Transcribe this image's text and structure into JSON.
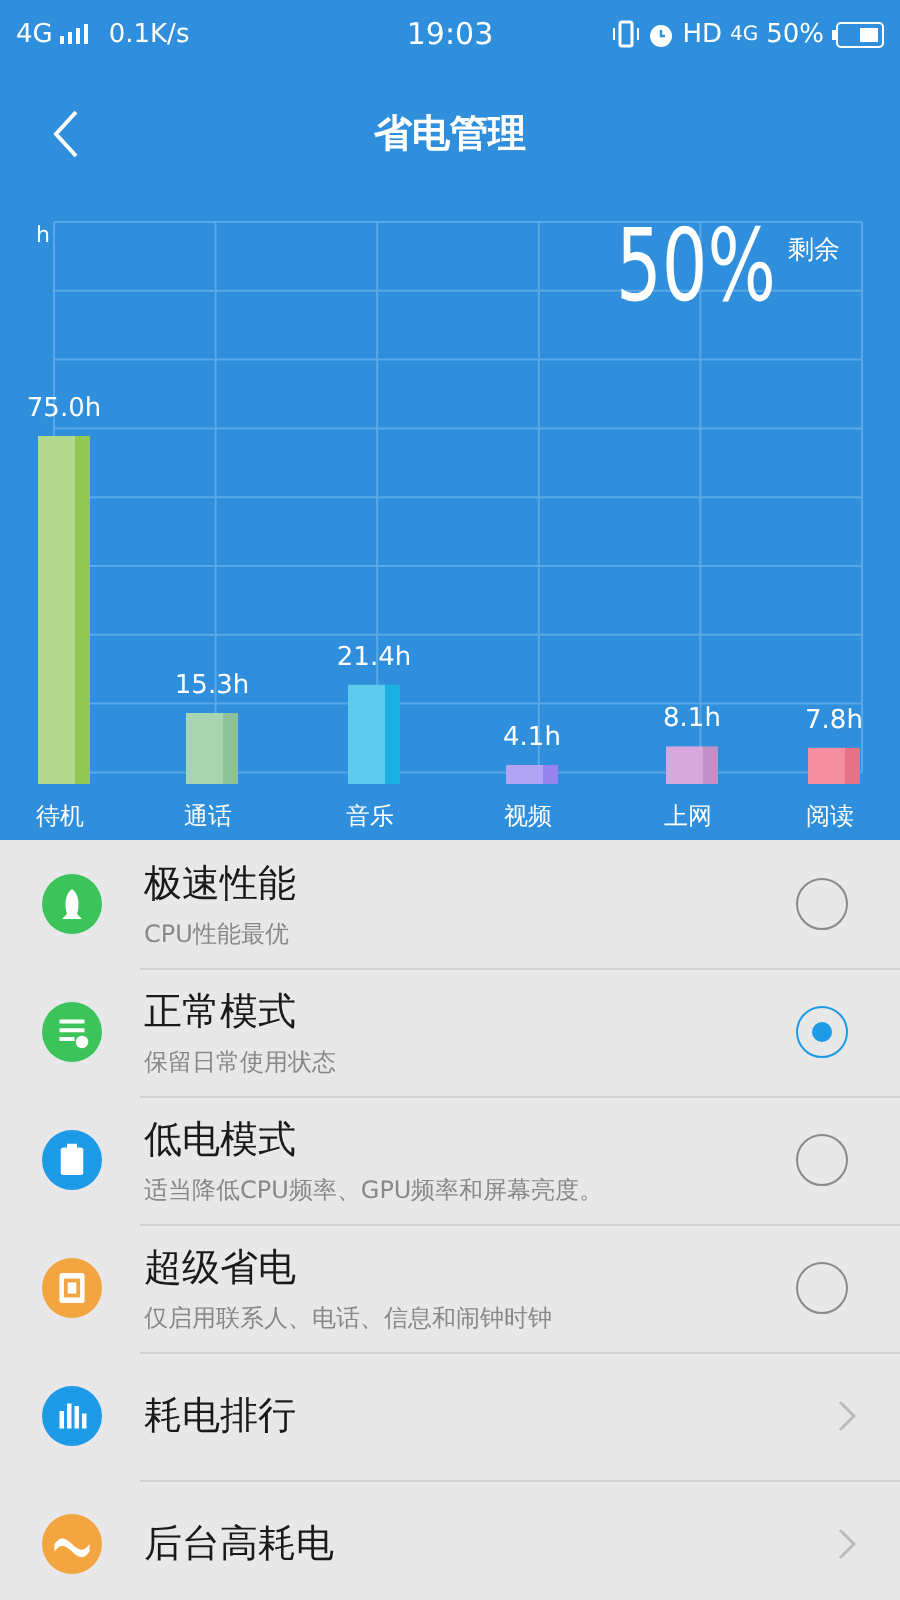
{
  "status_bar": {
    "network": "4G",
    "speed": "0.1K/s",
    "time": "19:03",
    "hd": "HD",
    "network_2": "4G",
    "battery": "50%"
  },
  "header": {
    "title": "省电管理"
  },
  "usage": {
    "remaining_percent": "50%",
    "remaining_label": "剩余",
    "chart_data": {
      "type": "bar",
      "annotations": [
        {
          "text": "h"
        }
      ],
      "categories": [
        "待机",
        "通话",
        "音乐",
        "视频",
        "上网",
        "阅读"
      ],
      "values": [
        75.0,
        15.3,
        21.4,
        4.1,
        8.1,
        7.8
      ],
      "value_labels": [
        "75.0h",
        "15.3h",
        "21.4h",
        "4.1h",
        "8.1h",
        "7.8h"
      ],
      "data_labels": true
    }
  },
  "modes": [
    {
      "kind": "radio",
      "title": "极速性能",
      "subtitle": "CPU性能最优",
      "selected": false,
      "color": "#3cc45a"
    },
    {
      "kind": "radio",
      "title": "正常模式",
      "subtitle": "保留日常使用状态",
      "selected": true,
      "color": "#3cc45a"
    },
    {
      "kind": "radio",
      "title": "低电模式",
      "subtitle": "适当降低CPU频率、GPU频率和屏幕亮度。",
      "selected": false,
      "color": "#1e9be6"
    },
    {
      "kind": "radio",
      "title": "超级省电",
      "subtitle": "仅启用联系人、电话、信息和闹钟时钟",
      "selected": false,
      "color": "#f2a540"
    },
    {
      "kind": "link",
      "title": "耗电排行",
      "color": "#1e9be6"
    },
    {
      "kind": "link",
      "title": "后台高耗电",
      "color": "#f2a540"
    }
  ]
}
